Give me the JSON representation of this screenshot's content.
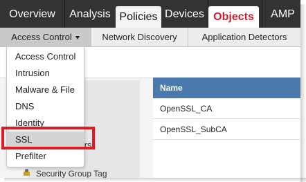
{
  "topnav": {
    "items": [
      {
        "label": "Overview"
      },
      {
        "label": "Analysis"
      },
      {
        "label": "Policies"
      },
      {
        "label": "Devices"
      },
      {
        "label": "Objects"
      },
      {
        "label": "AMP"
      }
    ],
    "active": "Policies",
    "highlighted": "Objects"
  },
  "subnav": {
    "items": [
      {
        "label": "Access Control"
      },
      {
        "label": "Network Discovery"
      },
      {
        "label": "Application Detectors"
      }
    ]
  },
  "dropdown": {
    "items": [
      {
        "label": "Access Control"
      },
      {
        "label": "Intrusion"
      },
      {
        "label": "Malware & File"
      },
      {
        "label": "DNS"
      },
      {
        "label": "Identity"
      },
      {
        "label": "SSL"
      },
      {
        "label": "Prefilter"
      }
    ],
    "hovered": "SSL"
  },
  "sidebar": {
    "partial_label": "lters",
    "security_group_tag": "Security Group Tag"
  },
  "table": {
    "header": "Name",
    "rows": [
      "OpenSSL_CA",
      "OpenSSL_SubCA"
    ]
  },
  "colors": {
    "topnav_bg": "#333333",
    "objects_accent": "#cc1f2e",
    "table_header": "#4a7aad",
    "highlight_box": "#e01b22"
  }
}
